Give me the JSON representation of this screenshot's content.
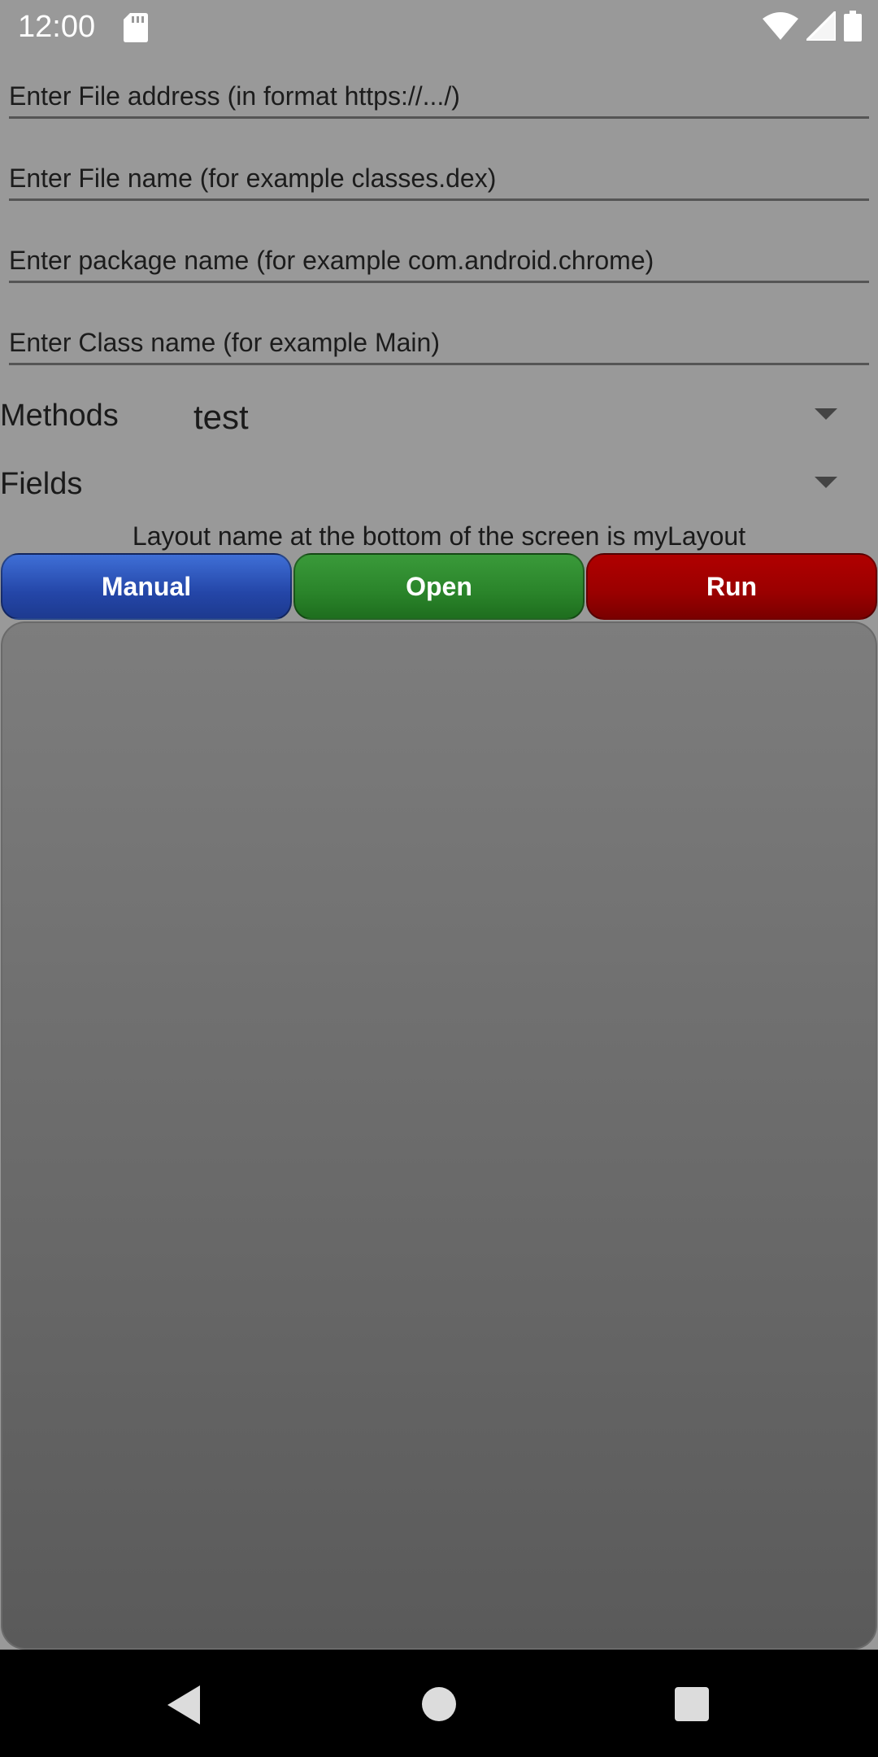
{
  "status_bar": {
    "time": "12:00",
    "icons": [
      "sd-card-icon",
      "wifi-icon",
      "signal-icon",
      "battery-icon"
    ]
  },
  "fields": {
    "file_address": {
      "placeholder": "Enter File address (in format https://.../)",
      "value": ""
    },
    "file_name": {
      "placeholder": "Enter File name (for example classes.dex)",
      "value": ""
    },
    "package_name": {
      "placeholder": "Enter package name (for example com.android.chrome)",
      "value": ""
    },
    "class_name": {
      "placeholder": "Enter Class name (for example Main)",
      "value": ""
    }
  },
  "methods": {
    "label": "Methods",
    "selected": "test"
  },
  "fields_spinner": {
    "label": "Fields",
    "selected": ""
  },
  "layout_note": "Layout name at the bottom of the screen is myLayout",
  "buttons": {
    "manual": "Manual",
    "open": "Open",
    "run": "Run"
  },
  "colors": {
    "background": "#999999",
    "manual_button": "#2a4fb5",
    "open_button": "#2a8a2a",
    "run_button": "#9a0000",
    "nav_bar": "#000000"
  },
  "nav_bar": {
    "icons": [
      "back-icon",
      "home-icon",
      "recents-icon"
    ]
  }
}
